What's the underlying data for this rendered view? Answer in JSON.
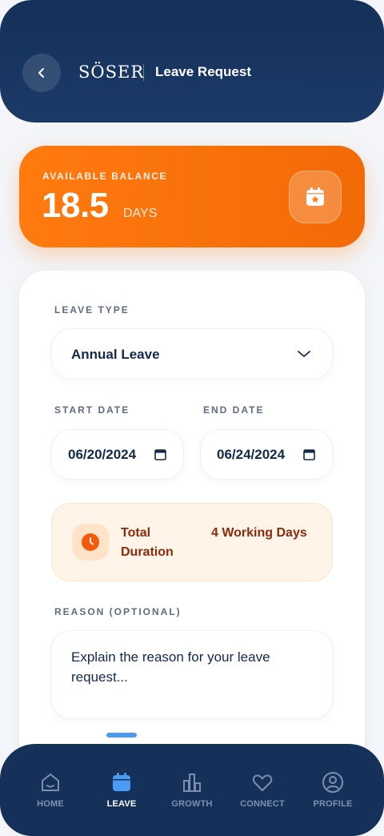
{
  "header": {
    "logo": "SÖSER",
    "title": "Leave Request",
    "back_icon": "chevron-left-icon"
  },
  "balance": {
    "label": "AVAILABLE BALANCE",
    "value": "18.5",
    "unit": "DAYS",
    "icon": "calendar-star-icon",
    "color": "#ff7a0f"
  },
  "form": {
    "leave_type_label": "LEAVE TYPE",
    "leave_type_value": "Annual Leave",
    "start_date_label": "START DATE",
    "start_date_value": "06/20/2024",
    "end_date_label": "END DATE",
    "end_date_value": "06/24/2024",
    "duration_label": "Total Duration",
    "duration_value": "4 Working Days",
    "reason_label": "REASON (OPTIONAL)",
    "reason_placeholder": "Explain the reason for your leave request..."
  },
  "nav": {
    "active": "LEAVE",
    "items": [
      {
        "label": "HOME",
        "icon": "home-icon"
      },
      {
        "label": "LEAVE",
        "icon": "calendar-icon"
      },
      {
        "label": "GROWTH",
        "icon": "bar-chart-icon"
      },
      {
        "label": "CONNECT",
        "icon": "heart-icon"
      },
      {
        "label": "PROFILE",
        "icon": "user-icon"
      }
    ]
  },
  "colors": {
    "navy": "#15315a",
    "orange": "#ff7a0f",
    "accent_blue": "#4b9bf5"
  }
}
